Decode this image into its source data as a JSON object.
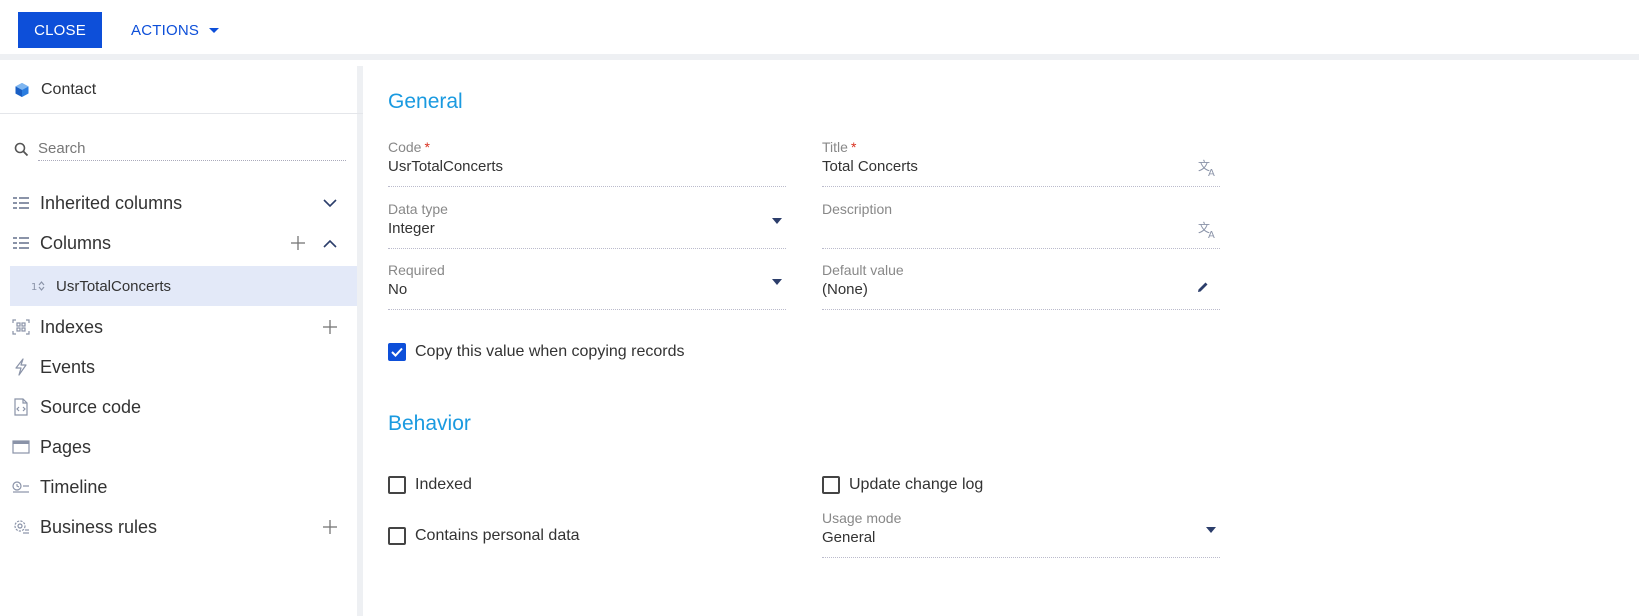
{
  "toolbar": {
    "close_label": "CLOSE",
    "actions_label": "ACTIONS"
  },
  "sidebar": {
    "entity_name": "Contact",
    "search_placeholder": "Search",
    "items": [
      {
        "label": "Inherited columns",
        "icon": "columns-icon"
      },
      {
        "label": "Columns",
        "icon": "columns-icon"
      },
      {
        "label": "Indexes",
        "icon": "indexes-icon"
      },
      {
        "label": "Events",
        "icon": "lightning-icon"
      },
      {
        "label": "Source code",
        "icon": "source-code-icon"
      },
      {
        "label": "Pages",
        "icon": "page-window-icon"
      },
      {
        "label": "Timeline",
        "icon": "timeline-icon"
      },
      {
        "label": "Business rules",
        "icon": "gear-rules-icon"
      }
    ],
    "selected_column": "UsrTotalConcerts"
  },
  "general": {
    "title": "General",
    "code_label": "Code",
    "code_value": "UsrTotalConcerts",
    "title_label": "Title",
    "title_value": "Total Concerts",
    "data_type_label": "Data type",
    "data_type_value": "Integer",
    "description_label": "Description",
    "description_value": "",
    "required_label": "Required",
    "required_value": "No",
    "default_label": "Default value",
    "default_value": "(None)",
    "copy_label": "Copy this value when copying records",
    "required_marker": "*"
  },
  "behavior": {
    "title": "Behavior",
    "indexed_label": "Indexed",
    "update_log_label": "Update change log",
    "personal_label": "Contains personal data",
    "usage_label": "Usage mode",
    "usage_value": "General"
  },
  "colors": {
    "accent": "#0d4fd9",
    "section_title": "#1a9ae0",
    "selected_bg": "#e3e9f8",
    "required": "#d9301f"
  }
}
